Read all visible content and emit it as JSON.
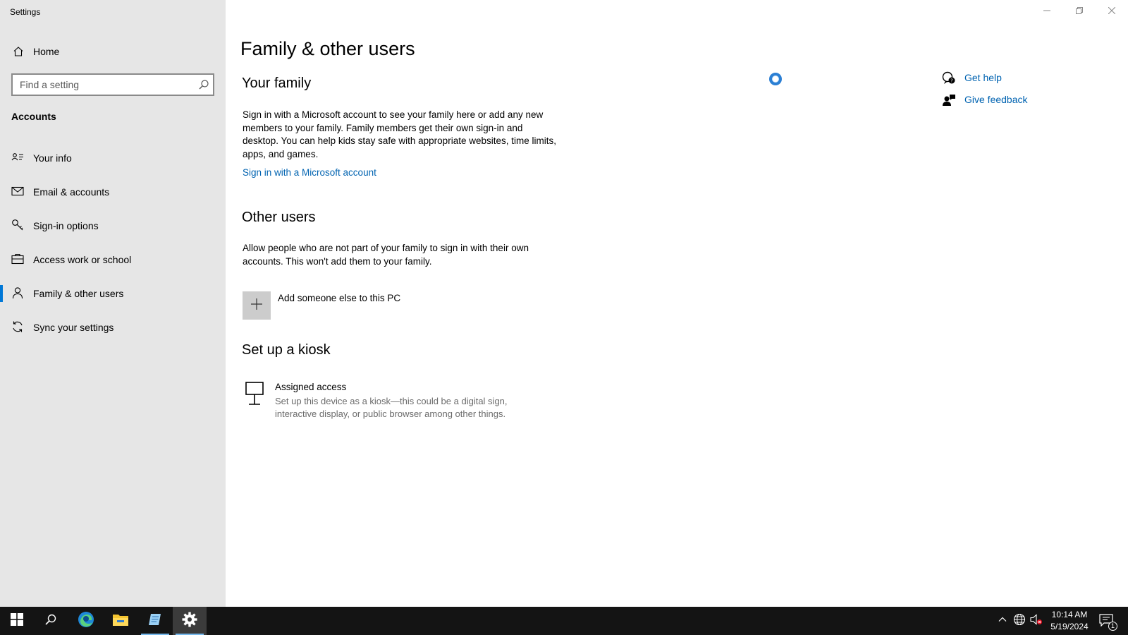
{
  "window": {
    "title": "Settings"
  },
  "sidebar": {
    "home_label": "Home",
    "search_placeholder": "Find a setting",
    "section_heading": "Accounts",
    "items": [
      {
        "label": "Your info",
        "icon": "contact-card-icon"
      },
      {
        "label": "Email & accounts",
        "icon": "mail-icon"
      },
      {
        "label": "Sign-in options",
        "icon": "key-icon"
      },
      {
        "label": "Access work or school",
        "icon": "briefcase-icon"
      },
      {
        "label": "Family & other users",
        "icon": "person-icon",
        "active": true
      },
      {
        "label": "Sync your settings",
        "icon": "sync-icon"
      }
    ]
  },
  "main": {
    "title": "Family & other users",
    "your_family": {
      "heading": "Your family",
      "description": "Sign in with a Microsoft account to see your family here or add any new members to your family. Family members get their own sign-in and desktop. You can help kids stay safe with appropriate websites, time limits, apps, and games.",
      "link": "Sign in with a Microsoft account"
    },
    "other_users": {
      "heading": "Other users",
      "description": "Allow people who are not part of your family to sign in with their own accounts. This won't add them to your family.",
      "add_label": "Add someone else to this PC"
    },
    "kiosk": {
      "heading": "Set up a kiosk",
      "title": "Assigned access",
      "description": "Set up this device as a kiosk—this could be a digital sign, interactive display, or public browser among other things."
    }
  },
  "help": {
    "get_help": "Get help",
    "give_feedback": "Give feedback"
  },
  "taskbar": {
    "time": "10:14 AM",
    "date": "5/19/2024",
    "notification_count": "1"
  },
  "colors": {
    "accent": "#0078d7",
    "link": "#0063b1",
    "sidebar_bg": "#e6e6e6",
    "taskbar_bg": "#141414"
  }
}
